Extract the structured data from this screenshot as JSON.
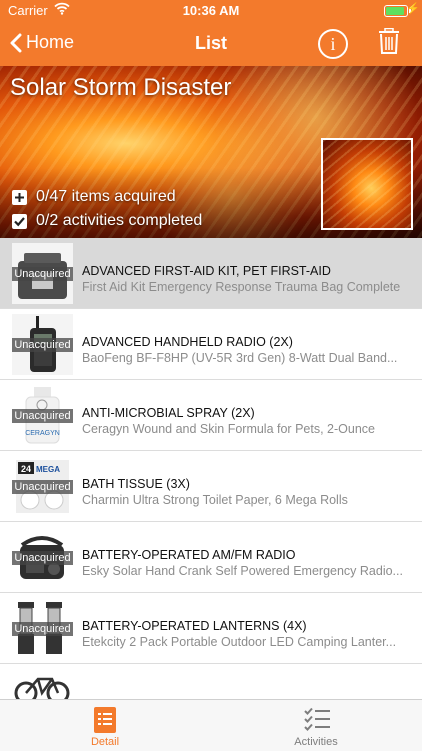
{
  "status_bar": {
    "carrier": "Carrier",
    "time": "10:36 AM"
  },
  "nav": {
    "back_label": "Home",
    "title": "List"
  },
  "hero": {
    "title": "Solar Storm Disaster",
    "items_acquired": "0/47 items acquired",
    "activities_completed": "0/2 activities completed"
  },
  "items": [
    {
      "status": "Unacquired",
      "name": "ADVANCED FIRST-AID KIT, PET FIRST-AID",
      "desc": "First Aid Kit Emergency Response Trauma Bag Complete"
    },
    {
      "status": "Unacquired",
      "name": "ADVANCED HANDHELD RADIO (2X)",
      "desc": "BaoFeng BF-F8HP (UV-5R 3rd Gen) 8-Watt Dual Band..."
    },
    {
      "status": "Unacquired",
      "name": "ANTI-MICROBIAL SPRAY (2X)",
      "desc": "Ceragyn Wound and Skin Formula for Pets, 2-Ounce"
    },
    {
      "status": "Unacquired",
      "name": "BATH TISSUE (3X)",
      "desc": "Charmin Ultra Strong Toilet Paper, 6 Mega Rolls"
    },
    {
      "status": "Unacquired",
      "name": "BATTERY-OPERATED AM/FM RADIO",
      "desc": "Esky Solar Hand Crank Self Powered Emergency Radio..."
    },
    {
      "status": "Unacquired",
      "name": "BATTERY-OPERATED LANTERNS (4X)",
      "desc": "Etekcity 2 Pack Portable Outdoor LED Camping Lanter..."
    }
  ],
  "product_images": {
    "spray_label": "CERAGYN",
    "tissue_badge": "24",
    "tissue_brand": "MEGA"
  },
  "tabs": {
    "detail": "Detail",
    "activities": "Activities"
  },
  "colors": {
    "accent": "#f37a2c",
    "inactive_tab": "#7d7d7d"
  }
}
